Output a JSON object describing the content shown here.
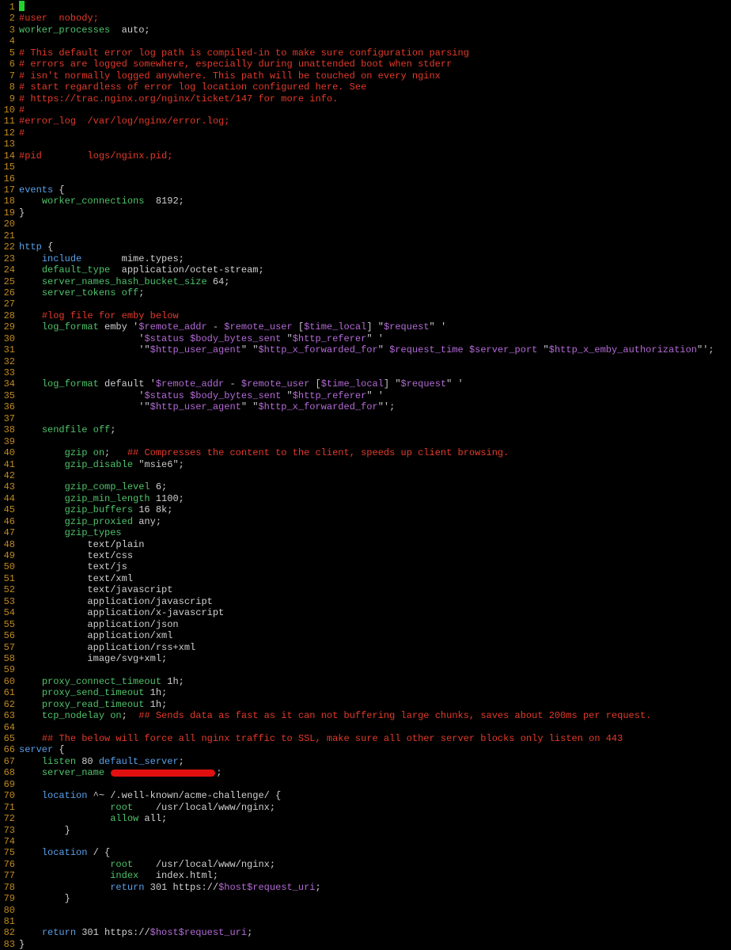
{
  "editor": {
    "lines": [
      {
        "n": "1",
        "tokens": [
          [
            "cursor",
            ""
          ]
        ]
      },
      {
        "n": "2",
        "tokens": [
          [
            "cmt",
            "#user  nobody;"
          ]
        ]
      },
      {
        "n": "3",
        "tokens": [
          [
            "dir",
            "worker_processes"
          ],
          [
            "txt",
            "  auto;"
          ]
        ]
      },
      {
        "n": "4",
        "tokens": []
      },
      {
        "n": "5",
        "tokens": [
          [
            "cmt",
            "# This default error log path is compiled-in to make sure configuration parsing"
          ]
        ]
      },
      {
        "n": "6",
        "tokens": [
          [
            "cmt",
            "# errors are logged somewhere, especially during unattended boot when stderr"
          ]
        ]
      },
      {
        "n": "7",
        "tokens": [
          [
            "cmt",
            "# isn't normally logged anywhere. This path will be touched on every nginx"
          ]
        ]
      },
      {
        "n": "8",
        "tokens": [
          [
            "cmt",
            "# start regardless of error log location configured here. See"
          ]
        ]
      },
      {
        "n": "9",
        "tokens": [
          [
            "cmt",
            "# https://trac.nginx.org/nginx/ticket/147 for more info."
          ]
        ]
      },
      {
        "n": "10",
        "tokens": [
          [
            "cmt",
            "#"
          ]
        ]
      },
      {
        "n": "11",
        "tokens": [
          [
            "cmt",
            "#error_log  /var/log/nginx/error.log;"
          ]
        ]
      },
      {
        "n": "12",
        "tokens": [
          [
            "cmt",
            "#"
          ]
        ]
      },
      {
        "n": "13",
        "tokens": []
      },
      {
        "n": "14",
        "tokens": [
          [
            "cmt",
            "#pid        logs/nginx.pid;"
          ]
        ]
      },
      {
        "n": "15",
        "tokens": []
      },
      {
        "n": "16",
        "tokens": []
      },
      {
        "n": "17",
        "tokens": [
          [
            "kw",
            "events"
          ],
          [
            "txt",
            " {"
          ]
        ]
      },
      {
        "n": "18",
        "tokens": [
          [
            "txt",
            "    "
          ],
          [
            "dir",
            "worker_connections"
          ],
          [
            "txt",
            "  8192;"
          ]
        ]
      },
      {
        "n": "19",
        "tokens": [
          [
            "txt",
            "}"
          ]
        ]
      },
      {
        "n": "20",
        "tokens": []
      },
      {
        "n": "21",
        "tokens": []
      },
      {
        "n": "22",
        "tokens": [
          [
            "kw",
            "http"
          ],
          [
            "txt",
            " {"
          ]
        ]
      },
      {
        "n": "23",
        "tokens": [
          [
            "txt",
            "    "
          ],
          [
            "kw",
            "include"
          ],
          [
            "txt",
            "       mime.types;"
          ]
        ]
      },
      {
        "n": "24",
        "tokens": [
          [
            "txt",
            "    "
          ],
          [
            "dir",
            "default_type"
          ],
          [
            "txt",
            "  application/octet-stream;"
          ]
        ]
      },
      {
        "n": "25",
        "tokens": [
          [
            "txt",
            "    "
          ],
          [
            "dir",
            "server_names_hash_bucket_size"
          ],
          [
            "txt",
            " 64;"
          ]
        ]
      },
      {
        "n": "26",
        "tokens": [
          [
            "txt",
            "    "
          ],
          [
            "dir",
            "server_tokens"
          ],
          [
            "txt",
            " "
          ],
          [
            "val",
            "off"
          ],
          [
            "txt",
            ";"
          ]
        ]
      },
      {
        "n": "27",
        "tokens": []
      },
      {
        "n": "28",
        "tokens": [
          [
            "txt",
            "    "
          ],
          [
            "cmt",
            "#log file for emby below"
          ]
        ]
      },
      {
        "n": "29",
        "tokens": [
          [
            "txt",
            "    "
          ],
          [
            "dir",
            "log_format"
          ],
          [
            "txt",
            " emby "
          ],
          [
            "str",
            "'"
          ],
          [
            "var",
            "$remote_addr"
          ],
          [
            "str",
            " - "
          ],
          [
            "var",
            "$remote_user"
          ],
          [
            "str",
            " ["
          ],
          [
            "var",
            "$time_local"
          ],
          [
            "str",
            "] \""
          ],
          [
            "var",
            "$request"
          ],
          [
            "str",
            "\" '"
          ]
        ]
      },
      {
        "n": "30",
        "tokens": [
          [
            "txt",
            "                     "
          ],
          [
            "str",
            "'"
          ],
          [
            "var",
            "$status"
          ],
          [
            "str",
            " "
          ],
          [
            "var",
            "$body_bytes_sent"
          ],
          [
            "str",
            " \""
          ],
          [
            "var",
            "$http_referer"
          ],
          [
            "str",
            "\" '"
          ]
        ]
      },
      {
        "n": "31",
        "tokens": [
          [
            "txt",
            "                     "
          ],
          [
            "str",
            "'\""
          ],
          [
            "var",
            "$http_user_agent"
          ],
          [
            "str",
            "\" \""
          ],
          [
            "var",
            "$http_x_forwarded_for"
          ],
          [
            "str",
            "\" "
          ],
          [
            "var",
            "$request_time"
          ],
          [
            "str",
            " "
          ],
          [
            "var",
            "$server_port"
          ],
          [
            "str",
            " \""
          ],
          [
            "var",
            "$http_x_emby_authorization"
          ],
          [
            "str",
            "\"';"
          ]
        ]
      },
      {
        "n": "32",
        "tokens": []
      },
      {
        "n": "33",
        "tokens": []
      },
      {
        "n": "34",
        "tokens": [
          [
            "txt",
            "    "
          ],
          [
            "dir",
            "log_format"
          ],
          [
            "txt",
            " default "
          ],
          [
            "str",
            "'"
          ],
          [
            "var",
            "$remote_addr"
          ],
          [
            "str",
            " - "
          ],
          [
            "var",
            "$remote_user"
          ],
          [
            "str",
            " ["
          ],
          [
            "var",
            "$time_local"
          ],
          [
            "str",
            "] \""
          ],
          [
            "var",
            "$request"
          ],
          [
            "str",
            "\" '"
          ]
        ]
      },
      {
        "n": "35",
        "tokens": [
          [
            "txt",
            "                     "
          ],
          [
            "str",
            "'"
          ],
          [
            "var",
            "$status"
          ],
          [
            "str",
            " "
          ],
          [
            "var",
            "$body_bytes_sent"
          ],
          [
            "str",
            " \""
          ],
          [
            "var",
            "$http_referer"
          ],
          [
            "str",
            "\" '"
          ]
        ]
      },
      {
        "n": "36",
        "tokens": [
          [
            "txt",
            "                     "
          ],
          [
            "str",
            "'\""
          ],
          [
            "var",
            "$http_user_agent"
          ],
          [
            "str",
            "\" \""
          ],
          [
            "var",
            "$http_x_forwarded_for"
          ],
          [
            "str",
            "\"';"
          ]
        ]
      },
      {
        "n": "37",
        "tokens": []
      },
      {
        "n": "38",
        "tokens": [
          [
            "txt",
            "    "
          ],
          [
            "dir",
            "sendfile"
          ],
          [
            "txt",
            " "
          ],
          [
            "val",
            "off"
          ],
          [
            "txt",
            ";"
          ]
        ]
      },
      {
        "n": "39",
        "tokens": []
      },
      {
        "n": "40",
        "tokens": [
          [
            "txt",
            "        "
          ],
          [
            "dir",
            "gzip"
          ],
          [
            "txt",
            " "
          ],
          [
            "val",
            "on"
          ],
          [
            "txt",
            ";   "
          ],
          [
            "cmt",
            "## Compresses the content to the client, speeds up client browsing."
          ]
        ]
      },
      {
        "n": "41",
        "tokens": [
          [
            "txt",
            "        "
          ],
          [
            "dir",
            "gzip_disable"
          ],
          [
            "txt",
            " "
          ],
          [
            "str",
            "\"msie6\""
          ],
          [
            "txt",
            ";"
          ]
        ]
      },
      {
        "n": "42",
        "tokens": []
      },
      {
        "n": "43",
        "tokens": [
          [
            "txt",
            "        "
          ],
          [
            "dir",
            "gzip_comp_level"
          ],
          [
            "txt",
            " 6;"
          ]
        ]
      },
      {
        "n": "44",
        "tokens": [
          [
            "txt",
            "        "
          ],
          [
            "dir",
            "gzip_min_length"
          ],
          [
            "txt",
            " 1100;"
          ]
        ]
      },
      {
        "n": "45",
        "tokens": [
          [
            "txt",
            "        "
          ],
          [
            "dir",
            "gzip_buffers"
          ],
          [
            "txt",
            " 16 8k;"
          ]
        ]
      },
      {
        "n": "46",
        "tokens": [
          [
            "txt",
            "        "
          ],
          [
            "dir",
            "gzip_proxied"
          ],
          [
            "txt",
            " any;"
          ]
        ]
      },
      {
        "n": "47",
        "tokens": [
          [
            "txt",
            "        "
          ],
          [
            "dir",
            "gzip_types"
          ]
        ]
      },
      {
        "n": "48",
        "tokens": [
          [
            "txt",
            "            text/plain"
          ]
        ]
      },
      {
        "n": "49",
        "tokens": [
          [
            "txt",
            "            text/css"
          ]
        ]
      },
      {
        "n": "50",
        "tokens": [
          [
            "txt",
            "            text/js"
          ]
        ]
      },
      {
        "n": "51",
        "tokens": [
          [
            "txt",
            "            text/xml"
          ]
        ]
      },
      {
        "n": "52",
        "tokens": [
          [
            "txt",
            "            text/javascript"
          ]
        ]
      },
      {
        "n": "53",
        "tokens": [
          [
            "txt",
            "            application/javascript"
          ]
        ]
      },
      {
        "n": "54",
        "tokens": [
          [
            "txt",
            "            application/x-javascript"
          ]
        ]
      },
      {
        "n": "55",
        "tokens": [
          [
            "txt",
            "            application/json"
          ]
        ]
      },
      {
        "n": "56",
        "tokens": [
          [
            "txt",
            "            application/xml"
          ]
        ]
      },
      {
        "n": "57",
        "tokens": [
          [
            "txt",
            "            application/rss+xml"
          ]
        ]
      },
      {
        "n": "58",
        "tokens": [
          [
            "txt",
            "            image/svg+xml;"
          ]
        ]
      },
      {
        "n": "59",
        "tokens": []
      },
      {
        "n": "60",
        "tokens": [
          [
            "txt",
            "    "
          ],
          [
            "dir",
            "proxy_connect_timeout"
          ],
          [
            "txt",
            " 1h;"
          ]
        ]
      },
      {
        "n": "61",
        "tokens": [
          [
            "txt",
            "    "
          ],
          [
            "dir",
            "proxy_send_timeout"
          ],
          [
            "txt",
            " 1h;"
          ]
        ]
      },
      {
        "n": "62",
        "tokens": [
          [
            "txt",
            "    "
          ],
          [
            "dir",
            "proxy_read_timeout"
          ],
          [
            "txt",
            " 1h;"
          ]
        ]
      },
      {
        "n": "63",
        "tokens": [
          [
            "txt",
            "    "
          ],
          [
            "dir",
            "tcp_nodelay"
          ],
          [
            "txt",
            " "
          ],
          [
            "val",
            "on"
          ],
          [
            "txt",
            ";  "
          ],
          [
            "cmt",
            "## Sends data as fast as it can not buffering large chunks, saves about 200ms per request."
          ]
        ]
      },
      {
        "n": "64",
        "tokens": []
      },
      {
        "n": "65",
        "tokens": [
          [
            "txt",
            "    "
          ],
          [
            "cmt",
            "## The below will force all nginx traffic to SSL, make sure all other server blocks only listen on 443"
          ]
        ]
      },
      {
        "n": "66",
        "tokens": [
          [
            "kw",
            "server"
          ],
          [
            "txt",
            " {"
          ]
        ]
      },
      {
        "n": "67",
        "tokens": [
          [
            "txt",
            "    "
          ],
          [
            "dir",
            "listen"
          ],
          [
            "txt",
            " 80 "
          ],
          [
            "kw",
            "default_server"
          ],
          [
            "txt",
            ";"
          ]
        ]
      },
      {
        "n": "68",
        "tokens": [
          [
            "txt",
            "    "
          ],
          [
            "dir",
            "server_name"
          ],
          [
            "txt",
            " "
          ],
          [
            "redact",
            ""
          ],
          [
            "txt",
            ";"
          ]
        ]
      },
      {
        "n": "69",
        "tokens": []
      },
      {
        "n": "70",
        "tokens": [
          [
            "txt",
            "    "
          ],
          [
            "kw",
            "location"
          ],
          [
            "txt",
            " ^~ /.well-known/acme-challenge/ {"
          ]
        ]
      },
      {
        "n": "71",
        "tokens": [
          [
            "txt",
            "                "
          ],
          [
            "dir",
            "root"
          ],
          [
            "txt",
            "    /usr/local/www/nginx;"
          ]
        ]
      },
      {
        "n": "72",
        "tokens": [
          [
            "txt",
            "                "
          ],
          [
            "dir",
            "allow"
          ],
          [
            "txt",
            " all;"
          ]
        ]
      },
      {
        "n": "73",
        "tokens": [
          [
            "txt",
            "        }"
          ]
        ]
      },
      {
        "n": "74",
        "tokens": []
      },
      {
        "n": "75",
        "tokens": [
          [
            "txt",
            "    "
          ],
          [
            "kw",
            "location"
          ],
          [
            "txt",
            " / {"
          ]
        ]
      },
      {
        "n": "76",
        "tokens": [
          [
            "txt",
            "                "
          ],
          [
            "dir",
            "root"
          ],
          [
            "txt",
            "    /usr/local/www/nginx;"
          ]
        ]
      },
      {
        "n": "77",
        "tokens": [
          [
            "txt",
            "                "
          ],
          [
            "dir",
            "index"
          ],
          [
            "txt",
            "   index.html;"
          ]
        ]
      },
      {
        "n": "78",
        "tokens": [
          [
            "txt",
            "                "
          ],
          [
            "kw",
            "return"
          ],
          [
            "txt",
            " 301 https://"
          ],
          [
            "var",
            "$host$request_uri"
          ],
          [
            "txt",
            ";"
          ]
        ]
      },
      {
        "n": "79",
        "tokens": [
          [
            "txt",
            "        }"
          ]
        ]
      },
      {
        "n": "80",
        "tokens": []
      },
      {
        "n": "81",
        "tokens": []
      },
      {
        "n": "82",
        "tokens": [
          [
            "txt",
            "    "
          ],
          [
            "kw",
            "return"
          ],
          [
            "txt",
            " 301 https://"
          ],
          [
            "var",
            "$host$request_uri"
          ],
          [
            "txt",
            ";"
          ]
        ]
      },
      {
        "n": "83",
        "tokens": [
          [
            "txt",
            "}"
          ]
        ]
      }
    ]
  }
}
